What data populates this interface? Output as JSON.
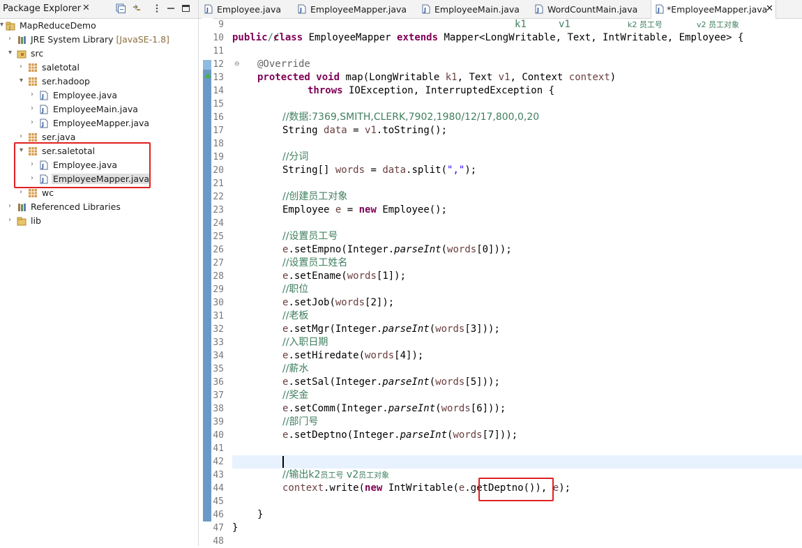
{
  "package_explorer": {
    "title": "Package Explorer",
    "close": "✕",
    "rows": [
      {
        "label": "MapReduceDemo",
        "icon": "java-project-icon"
      },
      {
        "label": "JRE System Library",
        "decoration": "[JavaSE-1.8]",
        "icon": "library-icon"
      },
      {
        "label": "src",
        "icon": "source-folder-icon"
      },
      {
        "label": "saletotal",
        "icon": "package-icon"
      },
      {
        "label": "ser.hadoop",
        "icon": "package-icon"
      },
      {
        "label": "Employee.java",
        "icon": "java-file-icon"
      },
      {
        "label": "EmployeeMain.java",
        "icon": "java-file-icon"
      },
      {
        "label": "EmployeeMapper.java",
        "icon": "java-file-icon"
      },
      {
        "label": "ser.java",
        "icon": "package-icon"
      },
      {
        "label": "ser.saletotal",
        "icon": "package-icon"
      },
      {
        "label": "Employee.java",
        "icon": "java-file-icon"
      },
      {
        "label": "EmployeeMapper.java",
        "icon": "java-file-icon"
      },
      {
        "label": "wc",
        "icon": "package-icon"
      },
      {
        "label": "Referenced Libraries",
        "icon": "library-icon"
      },
      {
        "label": "lib",
        "icon": "folder-icon"
      }
    ]
  },
  "editor_tabs": [
    {
      "label": "Employee.java"
    },
    {
      "label": "EmployeeMapper.java"
    },
    {
      "label": "EmployeeMain.java"
    },
    {
      "label": "WordCountMain.java"
    },
    {
      "label": "*EmployeeMapper.java",
      "active": true
    }
  ],
  "line_numbers": [
    "9",
    "10",
    "11",
    "12",
    "13",
    "14",
    "15",
    "16",
    "17",
    "18",
    "19",
    "20",
    "21",
    "22",
    "23",
    "24",
    "25",
    "26",
    "27",
    "28",
    "29",
    "30",
    "31",
    "32",
    "33",
    "34",
    "35",
    "36",
    "37",
    "38",
    "39",
    "40",
    "41",
    "42",
    "43",
    "44",
    "45",
    "46",
    "47",
    "48"
  ],
  "code": {
    "l9": "//",
    "l9_k1": "k1",
    "l9_v1": "v1",
    "l9_k2": "k2 员工号",
    "l9_v2": "v2 员工对象",
    "l10_a": "public",
    "l10_b": "class",
    "l10_c": " EmployeeMapper ",
    "l10_d": "extends",
    "l10_e": " Mapper<LongWritable, Text, IntWritable, Employee> {",
    "l12": "@Override",
    "l13_a": "protected",
    "l13_b": "void",
    "l13_c": " map(LongWritable ",
    "l13_k1": "k1",
    "l13_d": ", Text ",
    "l13_v1": "v1",
    "l13_e": ", Context ",
    "l13_ctx": "context",
    "l13_f": ")",
    "l14_a": "throws",
    "l14_b": " IOException, InterruptedException {",
    "l16": "//数据:7369,SMITH,CLERK,7902,1980/12/17,800,0,20",
    "l17_a": "String ",
    "l17_b": "data",
    "l17_c": " = ",
    "l17_d": "v1",
    "l17_e": ".toString();",
    "l19": "//分词",
    "l20_a": "String[] ",
    "l20_b": "words",
    "l20_c": " = ",
    "l20_d": "data",
    "l20_e": ".split(",
    "l20_f": "\",\"",
    "l20_g": ");",
    "l22": "//创建员工对象",
    "l23_a": "Employee ",
    "l23_b": "e",
    "l23_c": " = ",
    "l23_d": "new",
    "l23_e": " Employee();",
    "l25": "//设置员工号",
    "l26_a": "e",
    "l26_b": ".setEmpno(Integer.",
    "l26_c": "parseInt",
    "l26_d": "(",
    "l26_e": "words",
    "l26_f": "[0]));",
    "l27": "//设置员工姓名",
    "l28_a": "e",
    "l28_b": ".setEname(",
    "l28_c": "words",
    "l28_d": "[1]);",
    "l29": "//职位",
    "l30_a": "e",
    "l30_b": ".setJob(",
    "l30_c": "words",
    "l30_d": "[2]);",
    "l31": "//老板",
    "l32_a": "e",
    "l32_b": ".setMgr(Integer.",
    "l32_c": "parseInt",
    "l32_d": "(",
    "l32_e": "words",
    "l32_f": "[3]));",
    "l33": "//入职日期",
    "l34_a": "e",
    "l34_b": ".setHiredate(",
    "l34_c": "words",
    "l34_d": "[4]);",
    "l35": "//薪水",
    "l36_a": "e",
    "l36_b": ".setSal(Integer.",
    "l36_c": "parseInt",
    "l36_d": "(",
    "l36_e": "words",
    "l36_f": "[5]));",
    "l37": "//奖金",
    "l38_a": "e",
    "l38_b": ".setComm(Integer.",
    "l38_c": "parseInt",
    "l38_d": "(",
    "l38_e": "words",
    "l38_f": "[6]));",
    "l39": "//部门号",
    "l40_a": "e",
    "l40_b": ".setDeptno(Integer.",
    "l40_c": "parseInt",
    "l40_d": "(",
    "l40_e": "words",
    "l40_f": "[7]));",
    "l43_a": "//输出k2",
    "l43_b": "员工号",
    "l43_c": " v2",
    "l43_d": "员工对象",
    "l44_a": "context",
    "l44_b": ".write(",
    "l44_c": "new",
    "l44_d": " IntWritable(",
    "l44_e": "e",
    "l44_f": ".getDeptno()), ",
    "l44_g": "e",
    "l44_h": ");",
    "l46": "}",
    "l47": "}"
  },
  "colors": {
    "keyword": "#7f0055",
    "comment": "#3f7f5f",
    "string": "#2a00ff",
    "highlight_box": "#e02020",
    "change_bar": "#6a99c7",
    "current_line": "#e8f2fe"
  }
}
